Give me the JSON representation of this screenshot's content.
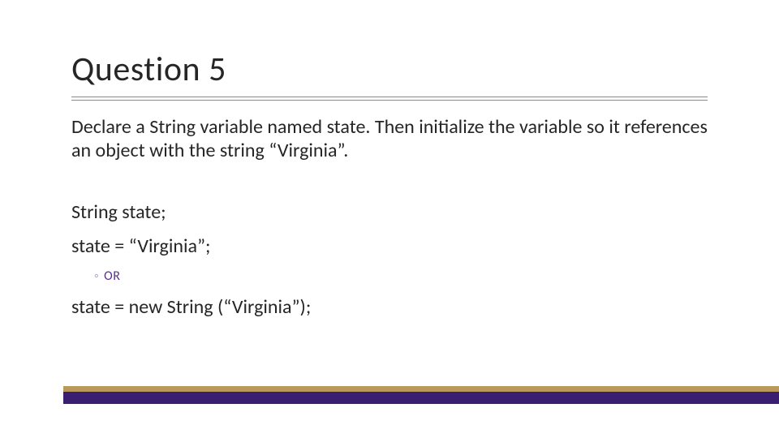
{
  "slide": {
    "title": "Question 5",
    "prompt": "Declare a String variable named state. Then initialize the variable so it references an object with the string “Virginia”.",
    "answer_line1": "String state;",
    "answer_line2": "state = “Virginia”;",
    "or_label": "OR",
    "answer_line3": "state = new String (“Virginia”);"
  },
  "theme": {
    "accent_gold": "#b89a5a",
    "accent_purple": "#3a1e70",
    "or_color": "#5c2e91"
  }
}
